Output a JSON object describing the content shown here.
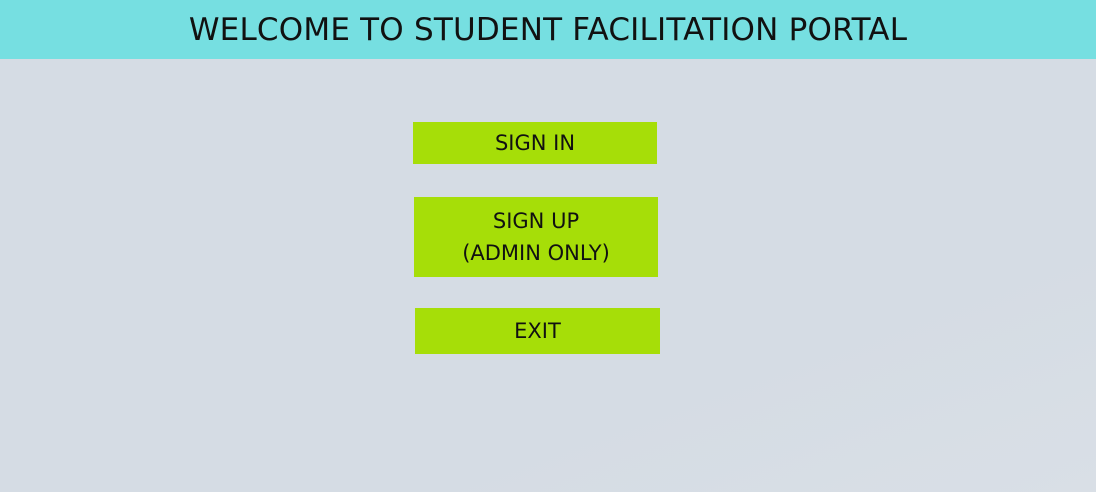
{
  "header": {
    "title": "WELCOME TO STUDENT FACILITATION PORTAL"
  },
  "buttons": {
    "sign_in": "SIGN IN",
    "sign_up_line1": "SIGN UP",
    "sign_up_line2": "(ADMIN ONLY)",
    "exit": "EXIT"
  },
  "colors": {
    "header_bg": "#76dfe1",
    "page_bg": "#d5dce4",
    "button_bg": "#a6de08",
    "text": "#111111"
  }
}
